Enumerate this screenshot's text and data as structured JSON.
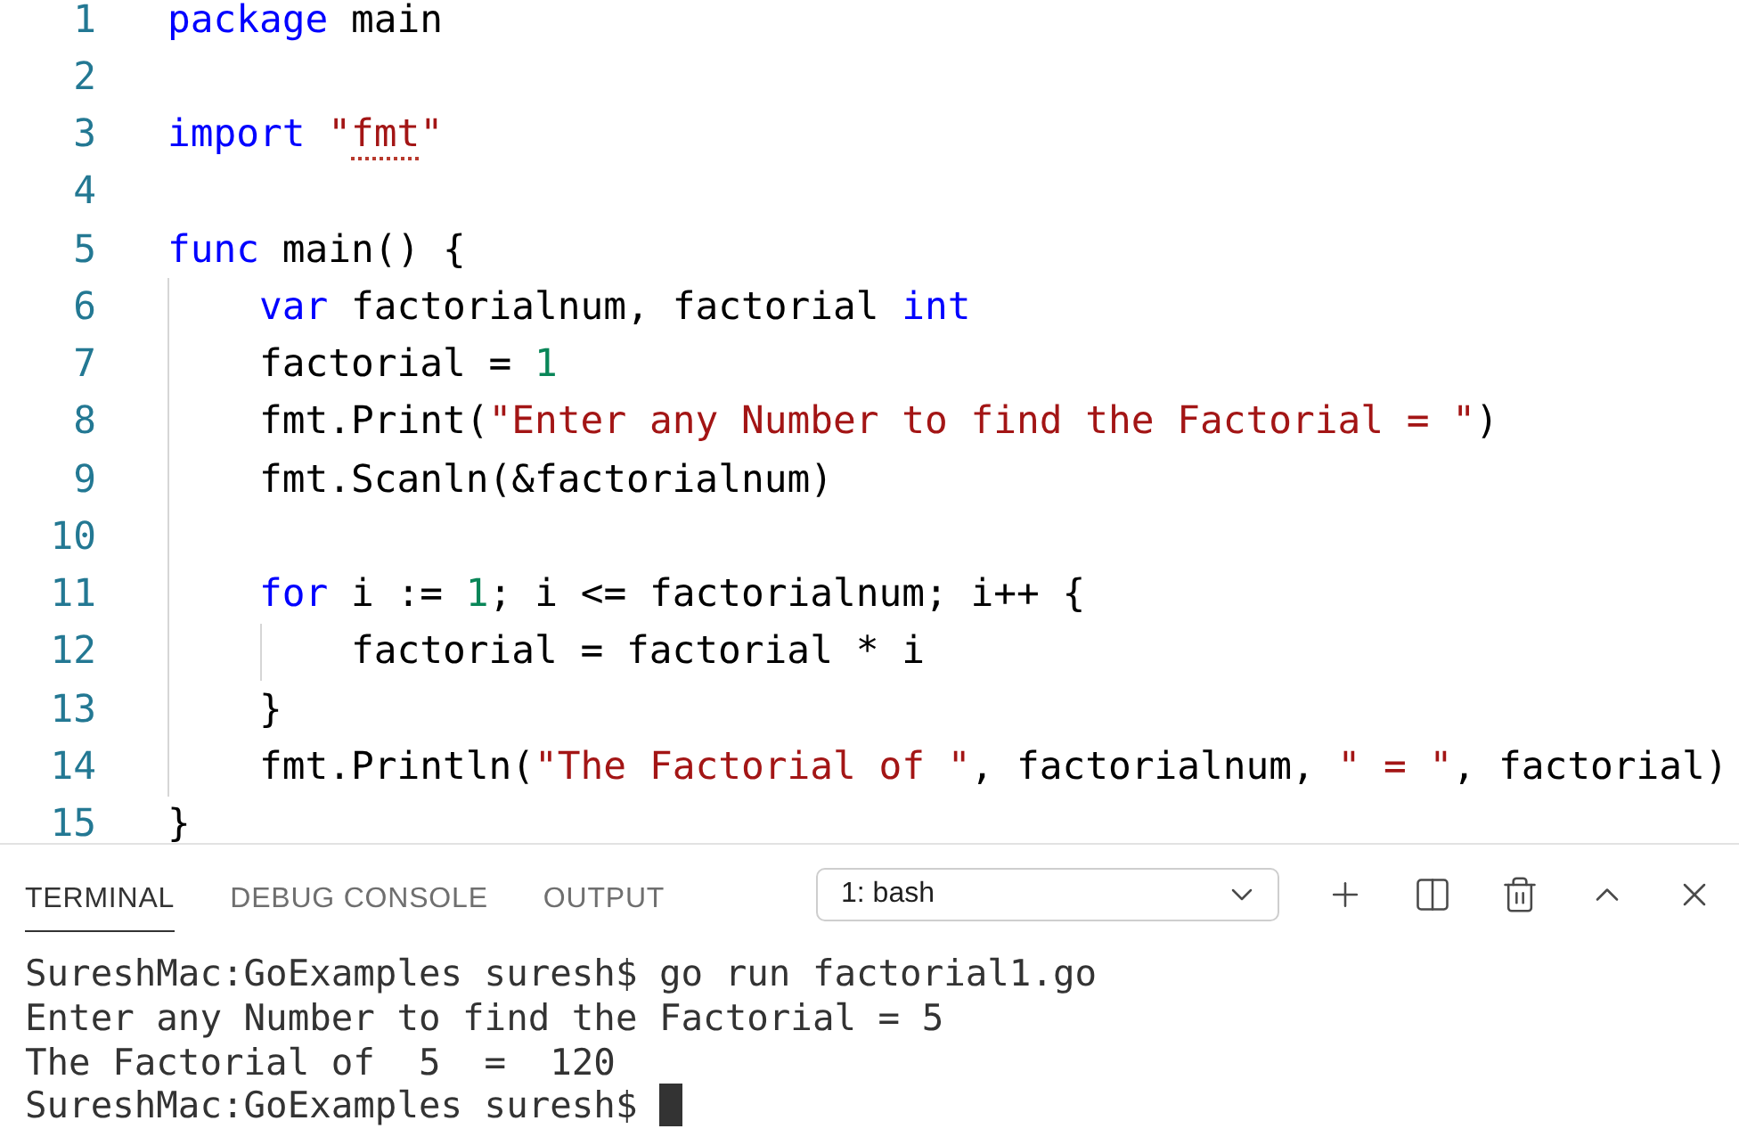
{
  "editor": {
    "lines": [
      {
        "number": "1",
        "tokens": [
          {
            "kind": "keyword",
            "text": "package"
          },
          {
            "kind": "plain",
            "text": " main"
          }
        ]
      },
      {
        "number": "2"
      },
      {
        "number": "3",
        "tokens": [
          {
            "kind": "keyword",
            "text": "import"
          },
          {
            "kind": "string",
            "text": " \""
          },
          {
            "kind": "flagged",
            "text": "fmt"
          },
          {
            "kind": "string",
            "text": "\""
          }
        ]
      },
      {
        "number": "4"
      },
      {
        "number": "5",
        "tokens": [
          {
            "kind": "keyword",
            "text": "func"
          },
          {
            "kind": "plain",
            "text": " main() {"
          }
        ],
        "children": [
          {
            "number": "6",
            "tokens": [
              {
                "kind": "keyword",
                "text": "var"
              },
              {
                "kind": "plain",
                "text": " factorialnum, factorial "
              },
              {
                "kind": "keyword",
                "text": "int"
              }
            ]
          },
          {
            "number": "7",
            "tokens": [
              {
                "kind": "plain",
                "text": "factorial = "
              },
              {
                "kind": "number",
                "text": "1"
              }
            ]
          },
          {
            "number": "8",
            "tokens": [
              {
                "kind": "plain",
                "text": "fmt.Print("
              },
              {
                "kind": "string",
                "text": "\"Enter any Number to find the Factorial = \""
              },
              {
                "kind": "plain",
                "text": ")"
              }
            ]
          },
          {
            "number": "9",
            "tokens": [
              {
                "kind": "plain",
                "text": "fmt.Scanln(&factorialnum)"
              }
            ]
          },
          {
            "number": "10"
          },
          {
            "number": "11",
            "tokens": [
              {
                "kind": "keyword",
                "text": "for"
              },
              {
                "kind": "plain",
                "text": " i := "
              },
              {
                "kind": "number",
                "text": "1"
              },
              {
                "kind": "plain",
                "text": "; i <= factorialnum; i++ {"
              }
            ],
            "children": [
              {
                "number": "12",
                "tokens": [
                  {
                    "kind": "plain",
                    "text": "factorial = factorial * i"
                  }
                ]
              }
            ]
          },
          {
            "number": "13",
            "tokens": [
              {
                "kind": "plain",
                "text": "}"
              }
            ]
          },
          {
            "number": "14",
            "tokens": [
              {
                "kind": "plain",
                "text": "fmt.Println("
              },
              {
                "kind": "string",
                "text": "\"The Factorial of \""
              },
              {
                "kind": "plain",
                "text": ", factorialnum, "
              },
              {
                "kind": "string",
                "text": "\" = \""
              },
              {
                "kind": "plain",
                "text": ", factorial)"
              }
            ]
          }
        ]
      },
      {
        "number": "15",
        "tokens": [
          {
            "kind": "plain",
            "text": "}"
          }
        ]
      }
    ]
  },
  "panel": {
    "tabs": [
      {
        "label": "TERMINAL",
        "selected": true
      },
      {
        "label": "DEBUG CONSOLE",
        "selected": false
      },
      {
        "label": "OUTPUT",
        "selected": false
      }
    ],
    "terminal_select": {
      "value": "1: bash"
    },
    "terminal": {
      "lines": [
        "SureshMac:GoExamples suresh$ go run factorial1.go",
        "Enter any Number to find the Factorial = 5",
        "The Factorial of  5  =  120"
      ],
      "prompt": "SureshMac:GoExamples suresh$"
    }
  }
}
